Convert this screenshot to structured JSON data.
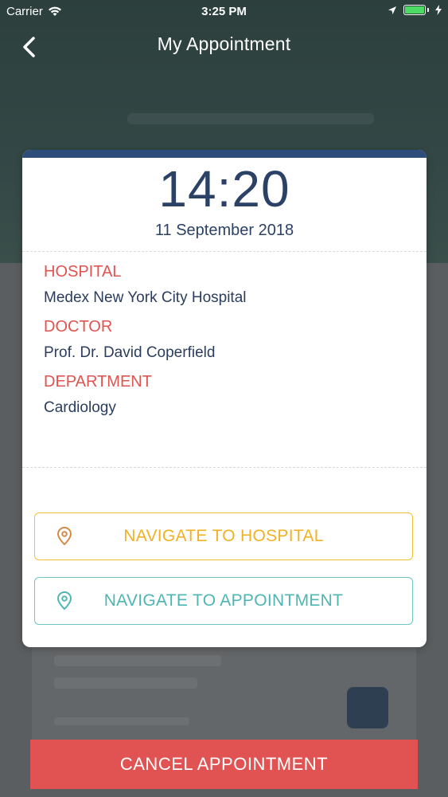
{
  "status_bar": {
    "carrier": "Carrier",
    "time": "3:25 PM",
    "icons": [
      "wifi-icon",
      "location-arrow-icon",
      "battery-icon",
      "charging-icon"
    ]
  },
  "nav": {
    "title": "My Appointment",
    "back_icon": "chevron-left-icon"
  },
  "appointment": {
    "time": "14:20",
    "date": "11 September 2018",
    "hospital_label": "HOSPITAL",
    "hospital_value": "Medex New York City Hospital",
    "doctor_label": "DOCTOR",
    "doctor_value": "Prof. Dr. David Coperfield",
    "department_label": "DEPARTMENT",
    "department_value": "Cardiology"
  },
  "actions": {
    "navigate_hospital": "NAVIGATE TO HOSPITAL",
    "navigate_appointment": "NAVIGATE TO APPOINTMENT",
    "cancel": "CANCEL APPOINTMENT"
  },
  "colors": {
    "accent_navy": "#2e4d7b",
    "label_red": "#e0534f",
    "hospital_yellow": "#f0b122",
    "appointment_teal": "#4fb5b2",
    "cancel_red": "#e05352"
  }
}
